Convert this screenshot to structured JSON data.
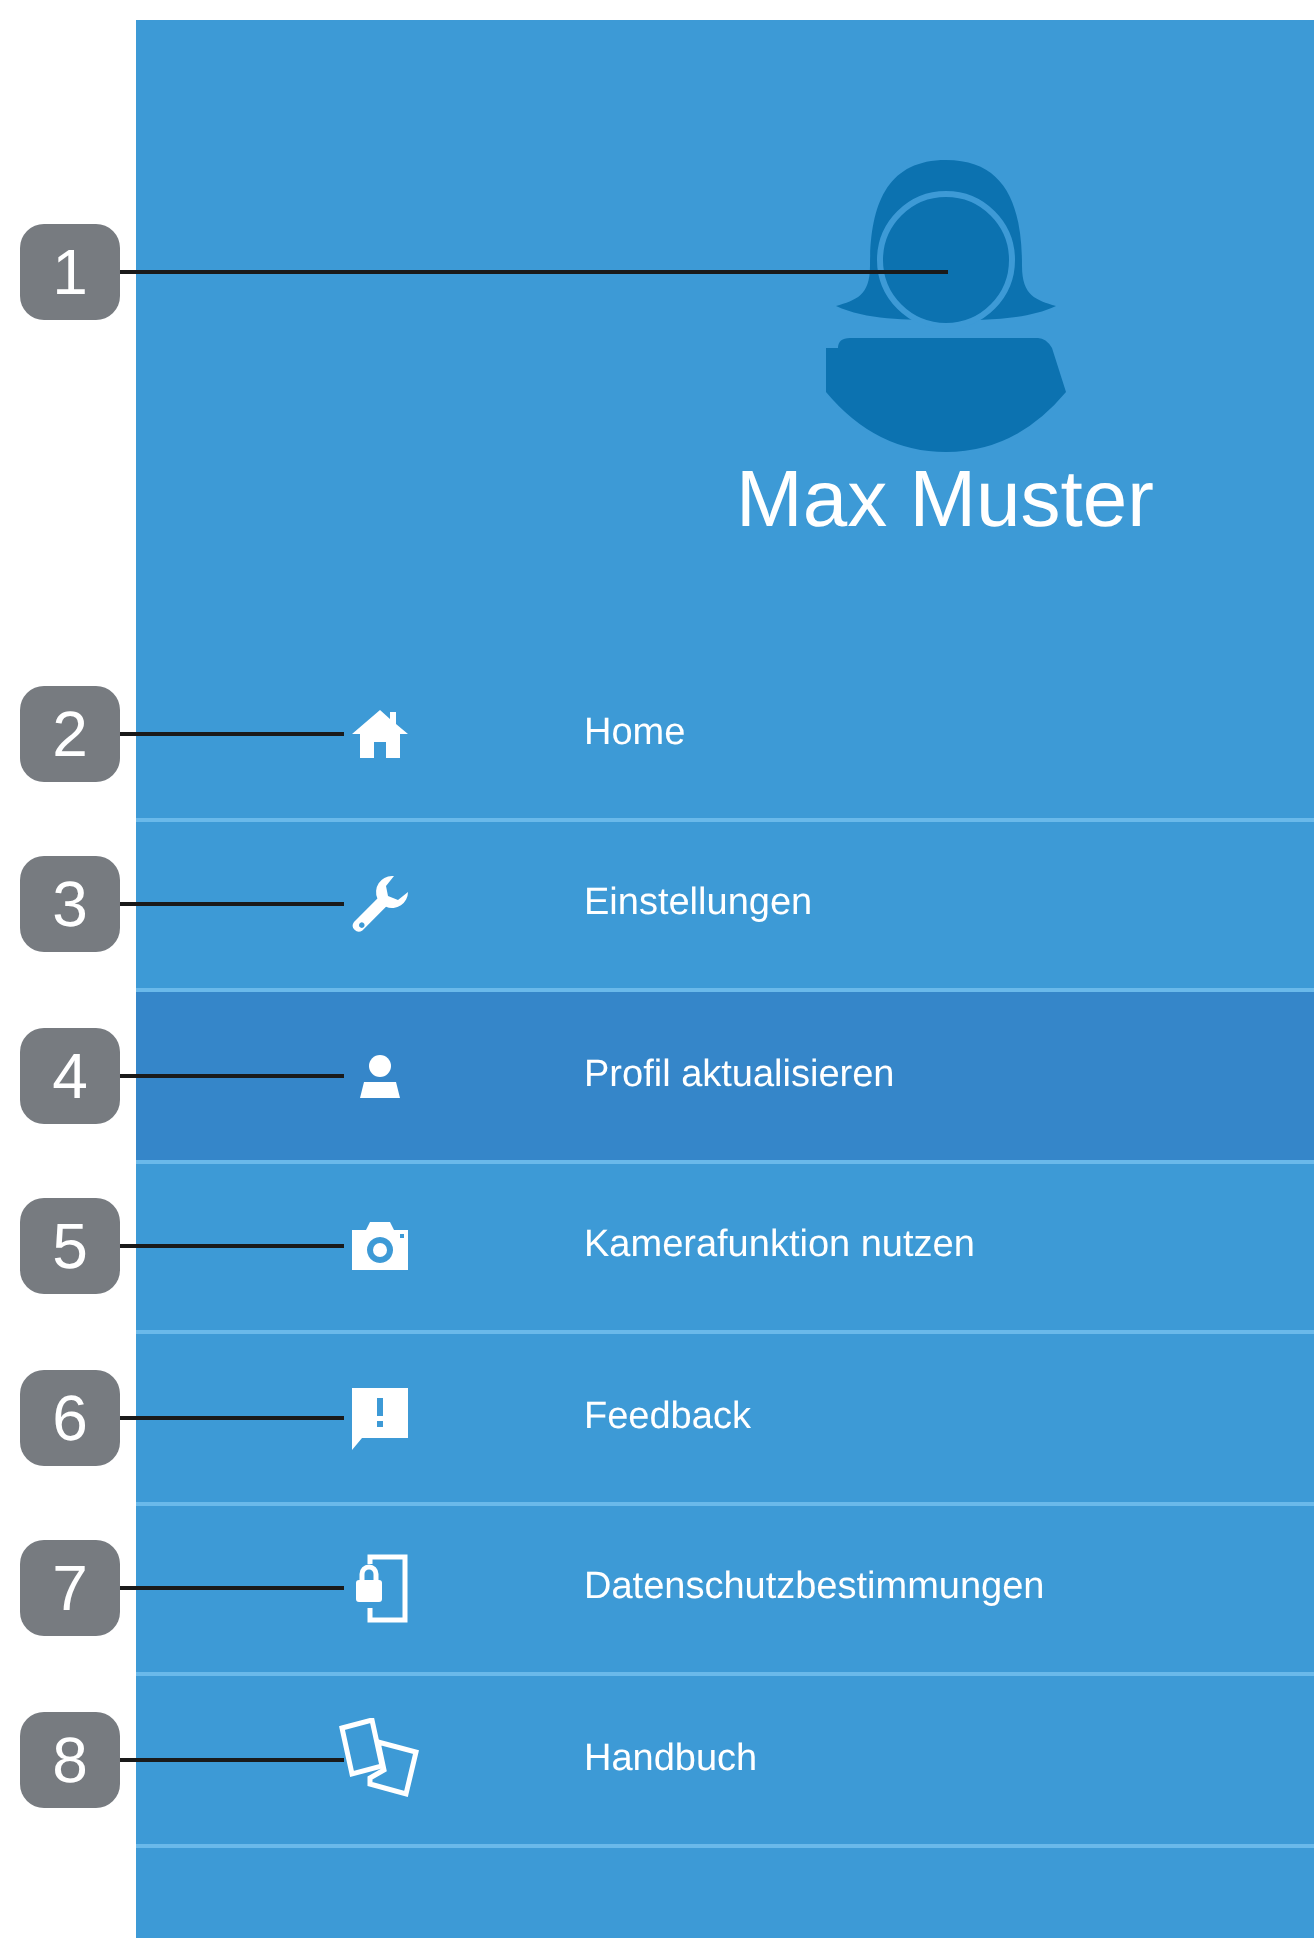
{
  "profile": {
    "callout": "1",
    "name": "Max Muster"
  },
  "menu": [
    {
      "callout": "2",
      "kind": "home",
      "label": "Home",
      "selected": false
    },
    {
      "callout": "3",
      "kind": "wrench",
      "label": "Einstellungen",
      "selected": false
    },
    {
      "callout": "4",
      "kind": "person",
      "label": "Profil aktualisieren",
      "selected": true
    },
    {
      "callout": "5",
      "kind": "camera",
      "label": "Kamerafunktion nutzen",
      "selected": false
    },
    {
      "callout": "6",
      "kind": "feedback",
      "label": "Feedback",
      "selected": false
    },
    {
      "callout": "7",
      "kind": "phonelock",
      "label": "Datenschutzbestimmungen",
      "selected": false
    },
    {
      "callout": "8",
      "kind": "pages",
      "label": "Handbuch",
      "selected": false
    }
  ]
}
